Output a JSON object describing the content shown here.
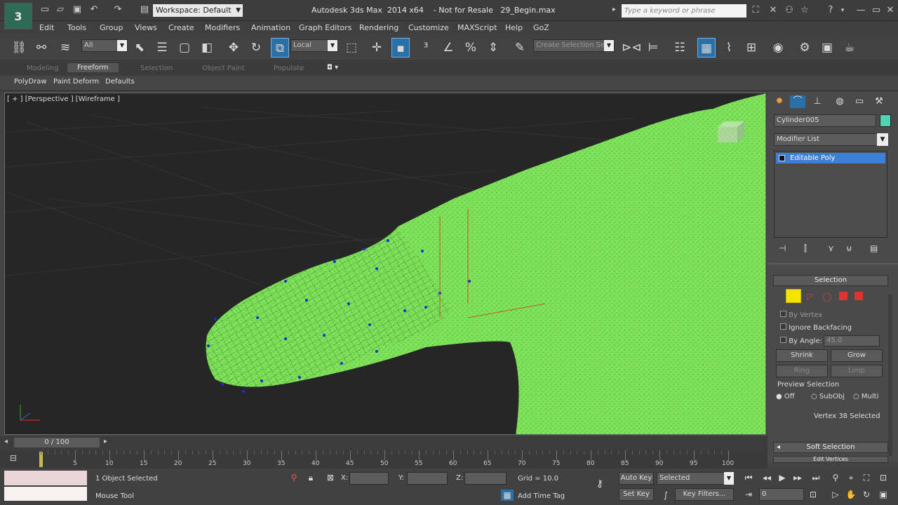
{
  "app": {
    "logo_text": "3",
    "title": "Autodesk 3ds Max  2014 x64    - Not for Resale   29_Begin.max",
    "workspace": "Workspace: Default",
    "search_placeholder": "Type a keyword or phrase"
  },
  "menus": [
    "Edit",
    "Tools",
    "Group",
    "Views",
    "Create",
    "Modifiers",
    "Animation",
    "Graph Editors",
    "Rendering",
    "Customize",
    "MAXScript",
    "Help",
    "GoZ"
  ],
  "toolbar": {
    "selection_filter": "All",
    "ref_coord": "Local",
    "named_selection": "Create Selection Se"
  },
  "ribbon": {
    "tabs": [
      "Modeling",
      "Freeform",
      "Selection",
      "Object Paint",
      "Populate"
    ],
    "active_tab": "Freeform",
    "subtabs": [
      "PolyDraw",
      "Paint Deform",
      "Defaults"
    ]
  },
  "viewport": {
    "label": "[ + ] [Perspective ] [Wireframe ]"
  },
  "command_panel": {
    "object_name": "Cylinder005",
    "modifier_list": "Modifier List",
    "stack_item": "Editable Poly",
    "selection_rollout": "Selection",
    "by_vertex": "By Vertex",
    "ignore_backfacing": "Ignore Backfacing",
    "by_angle": "By Angle:",
    "by_angle_value": "45.0",
    "shrink": "Shrink",
    "grow": "Grow",
    "ring": "Ring",
    "loop": "Loop",
    "preview_selection": "Preview Selection",
    "preview_options": [
      "Off",
      "SubObj",
      "Multi"
    ],
    "selected_text": "Vertex 38 Selected",
    "soft_selection": "Soft Selection",
    "edit_vertices": "Edit Vertices",
    "accent_color": "#3b7fd9"
  },
  "timeline": {
    "slider": "0 / 100",
    "ticks": [
      "5",
      "10",
      "15",
      "20",
      "25",
      "30",
      "35",
      "40",
      "45",
      "50",
      "55",
      "60",
      "65",
      "70",
      "75",
      "80",
      "85",
      "90",
      "95",
      "100"
    ]
  },
  "status": {
    "selected": "1 Object Selected",
    "prompt": "Mouse Tool",
    "x_label": "X:",
    "y_label": "Y:",
    "z_label": "Z:",
    "grid": "Grid = 10.0",
    "auto_key": "Auto Key",
    "set_key": "Set Key",
    "key_mode": "Selected",
    "key_filters": "Key Filters...",
    "add_time_tag": "Add Time Tag",
    "frame": "0"
  },
  "colors": {
    "mesh_green": "#7fe35a",
    "viewport_bg": "#262626",
    "vertex_blue": "#1a2fd6",
    "active_button": "#2b6fa7"
  }
}
